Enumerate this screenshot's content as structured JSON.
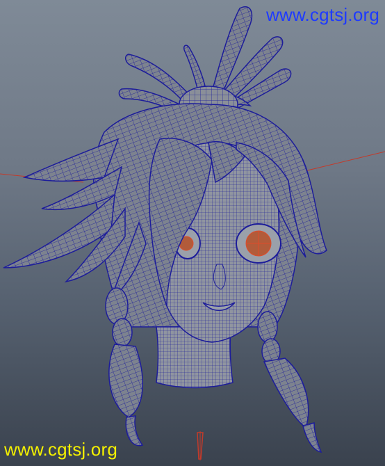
{
  "viewport": {
    "object_name": "anime-girl-head-wireframe-model",
    "colors": {
      "background_top": "#7f8a97",
      "background_bottom": "#3a424e",
      "wire_color": "#1d1d9a",
      "shaded_surface": "#8b909b",
      "axis_line": "#c33a2a"
    }
  },
  "watermarks": {
    "top_text": "www.cgtsj.org",
    "bottom_text": "www.cgtsj.org",
    "top_color": "#1f3bff",
    "bottom_color": "#f4f000"
  }
}
